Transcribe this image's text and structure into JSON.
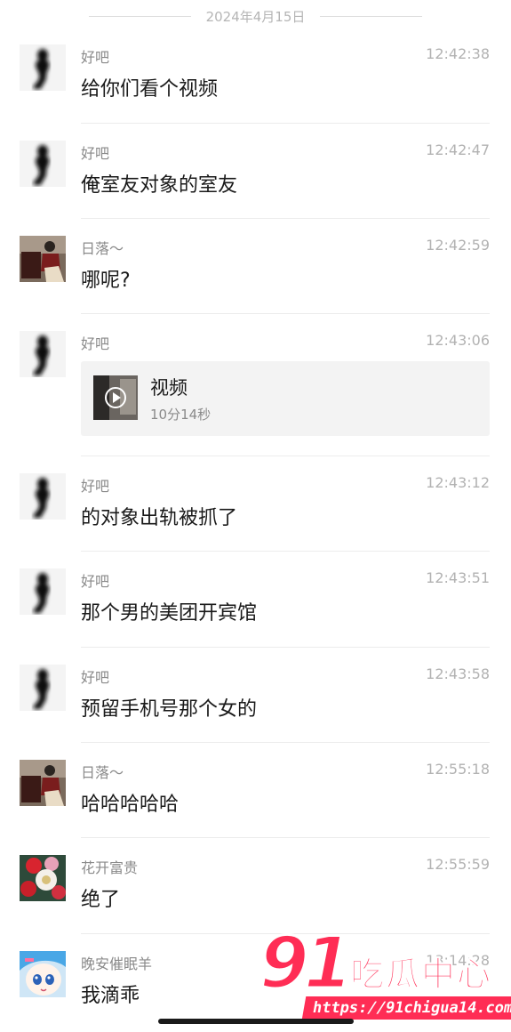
{
  "date_separator": "2024年4月15日",
  "messages": [
    {
      "sender": "好吧",
      "time": "12:42:38",
      "text": "给你们看个视频",
      "avatar": "dark-silhouette"
    },
    {
      "sender": "好吧",
      "time": "12:42:47",
      "text": "俺室友对象的室友",
      "avatar": "dark-silhouette"
    },
    {
      "sender": "日落～",
      "time": "12:42:59",
      "text": "哪呢?",
      "avatar": "photo-person-sitting"
    },
    {
      "sender": "好吧",
      "time": "12:43:06",
      "avatar": "dark-silhouette",
      "video": {
        "title": "视频",
        "duration": "10分14秒",
        "icon": "play-icon"
      }
    },
    {
      "sender": "好吧",
      "time": "12:43:12",
      "text": "的对象出轨被抓了",
      "avatar": "dark-silhouette"
    },
    {
      "sender": "好吧",
      "time": "12:43:51",
      "text": "那个男的美团开宾馆",
      "avatar": "dark-silhouette"
    },
    {
      "sender": "好吧",
      "time": "12:43:58",
      "text": "预留手机号那个女的",
      "avatar": "dark-silhouette"
    },
    {
      "sender": "日落～",
      "time": "12:55:18",
      "text": "哈哈哈哈哈",
      "avatar": "photo-person-sitting"
    },
    {
      "sender": "花开富贵",
      "time": "12:55:59",
      "text": "绝了",
      "avatar": "flowers"
    },
    {
      "sender": "晚安催眠羊",
      "time": "13:14:28",
      "text": "我滴乖",
      "avatar": "anime-character"
    }
  ],
  "watermark": {
    "number": "91",
    "brand": "吃瓜中心",
    "url": "https://91chigua14.com"
  },
  "colors": {
    "watermark": "#ff2d55",
    "divider": "#ececec",
    "meta_text": "#8a8a8a"
  }
}
